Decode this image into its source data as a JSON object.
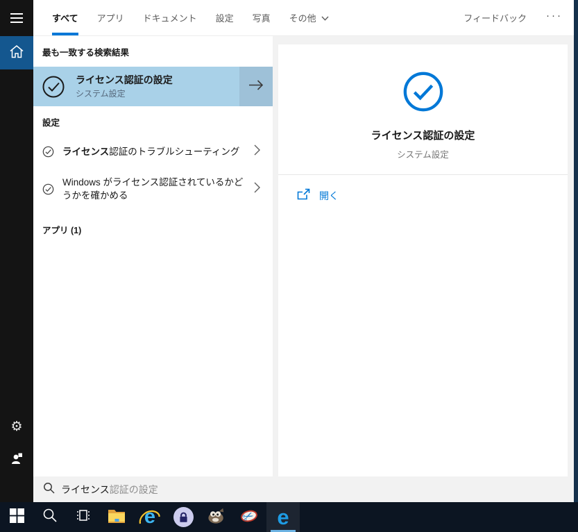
{
  "colors": {
    "accent": "#0078d7",
    "best_match_bg": "#a9d1e8",
    "arrow_button_bg": "#9ec1d8",
    "sidebar_home_bg": "#14578f",
    "taskbar_bg": "#0c1522"
  },
  "tabs": {
    "items": [
      "すべて",
      "アプリ",
      "ドキュメント",
      "設定",
      "写真",
      "その他"
    ],
    "active_tab": "すべて",
    "feedback_label": "フィードバック",
    "more_glyph": "···"
  },
  "results": {
    "best_match_header": "最も一致する検索結果",
    "best_match": {
      "title": "ライセンス認証の設定",
      "subtitle": "システム設定"
    },
    "settings_header": "設定",
    "settings_items": [
      {
        "bold": "ライセンス",
        "rest": "認証のトラブルシューティング"
      },
      {
        "bold": "",
        "rest": "Windows がライセンス認証されているかどうかを確かめる"
      }
    ],
    "apps_header": "アプリ (1)"
  },
  "preview": {
    "title": "ライセンス認証の設定",
    "subtitle": "システム設定",
    "open_label": "開く"
  },
  "search": {
    "typed": "ライセンス",
    "suggestion": "認証の設定"
  },
  "sidebar_icons": {
    "gear_glyph": "⚙"
  },
  "taskbar": {
    "icons": [
      "start",
      "search",
      "task-view",
      "file-explorer",
      "internet-explorer",
      "keepass",
      "gimp",
      "snipping-tool",
      "edge"
    ],
    "active_icon": "edge",
    "scissors_glyph": "✂",
    "ie_glyph": "e",
    "edge_glyph": "e"
  }
}
